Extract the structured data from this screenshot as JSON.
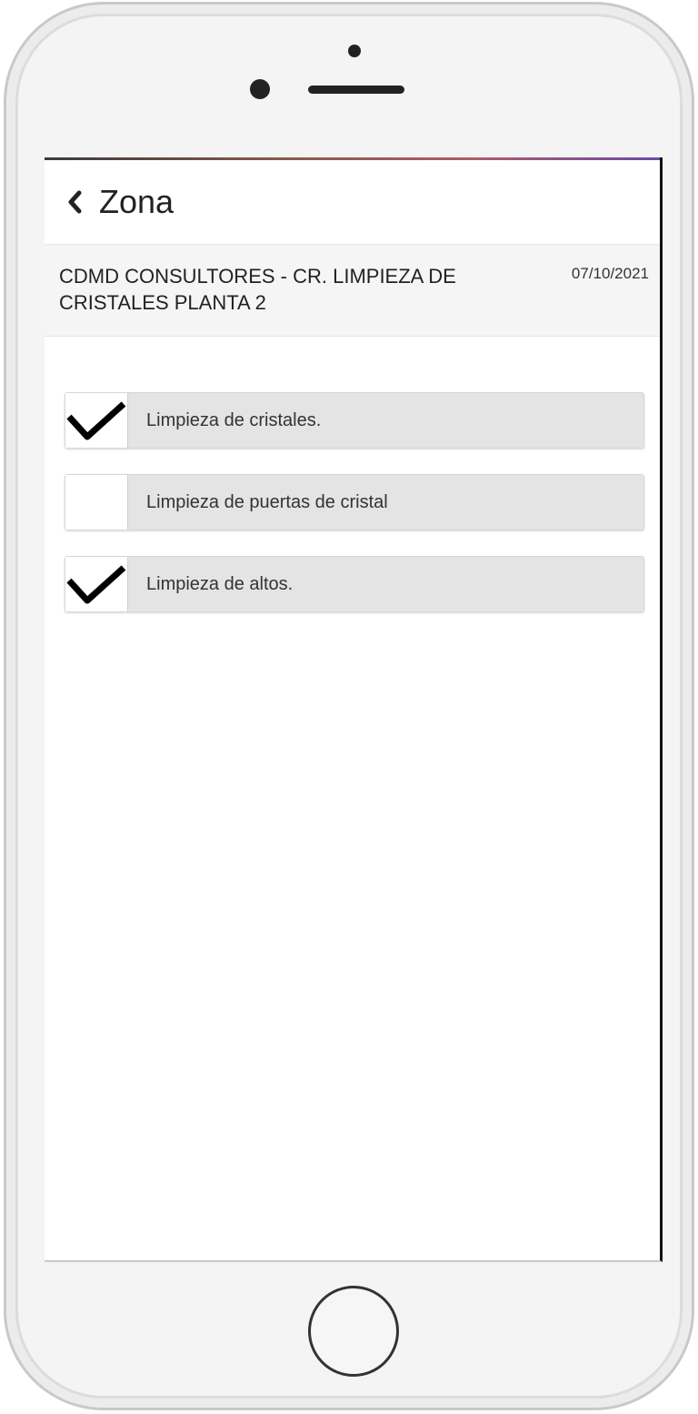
{
  "nav": {
    "back_icon": "chevron-left-icon",
    "title": "Zona"
  },
  "header": {
    "title": "CDMD CONSULTORES - CR. LIMPIEZA DE CRISTALES PLANTA 2",
    "date": "07/10/2021"
  },
  "tasks": [
    {
      "label": "Limpieza de cristales.",
      "checked": true
    },
    {
      "label": "Limpieza de puertas de cristal",
      "checked": false
    },
    {
      "label": "Limpieza de altos.",
      "checked": true
    }
  ],
  "device": {
    "home_button_icon": "home-button-icon"
  }
}
